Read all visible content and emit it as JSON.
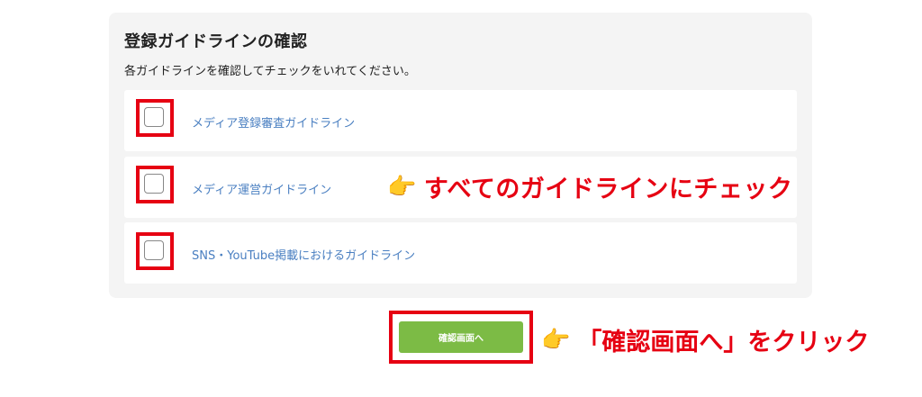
{
  "panel": {
    "title": "登録ガイドラインの確認",
    "description": "各ガイドラインを確認してチェックをいれてください。",
    "guidelines": [
      {
        "label": "メディア登録審査ガイドライン",
        "checked": false
      },
      {
        "label": "メディア運営ガイドライン",
        "checked": false
      },
      {
        "label": "SNS・YouTube掲載におけるガイドライン",
        "checked": false
      }
    ]
  },
  "annotations": {
    "check_all": "すべてのガイドラインにチェック",
    "click_confirm": "「確認画面へ」をクリック",
    "highlight_color": "#e60012",
    "pointer_icon": "pointing-hand-icon"
  },
  "actions": {
    "confirm_label": "確認画面へ",
    "confirm_color": "#7cbb45"
  }
}
